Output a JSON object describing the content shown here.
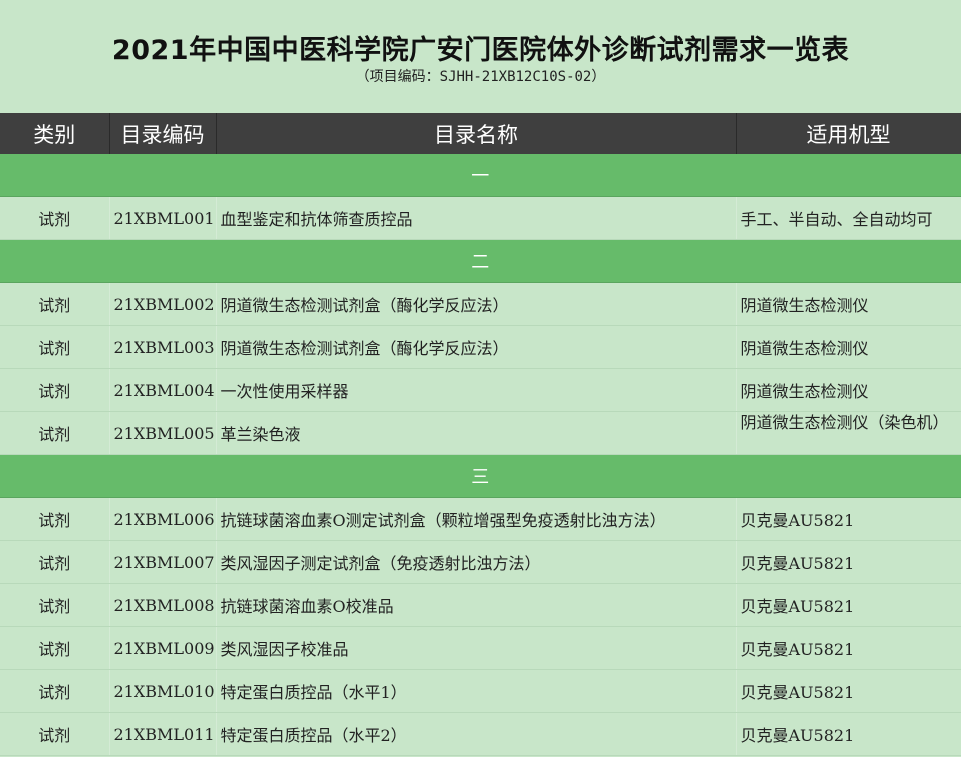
{
  "title": "2021年中国中医科学院广安门医院体外诊断试剂需求一览表",
  "subtitle": "（项目编码：SJHH-21XB12C10S-02）",
  "headers": [
    "类别",
    "目录编码",
    "目录名称",
    "适用机型"
  ],
  "sections": [
    {
      "label": "一",
      "rows": [
        {
          "category": "试剂",
          "code": "21XBML001",
          "name": "血型鉴定和抗体筛查质控品",
          "machine": "手工、半自动、全自动均可"
        }
      ]
    },
    {
      "label": "二",
      "rows": [
        {
          "category": "试剂",
          "code": "21XBML002",
          "name": "阴道微生态检测试剂盒（酶化学反应法）",
          "machine": "阴道微生态检测仪"
        },
        {
          "category": "试剂",
          "code": "21XBML003",
          "name": "阴道微生态检测试剂盒（酶化学反应法）",
          "machine": "阴道微生态检测仪"
        },
        {
          "category": "试剂",
          "code": "21XBML004",
          "name": "一次性使用采样器",
          "machine": "阴道微生态检测仪"
        },
        {
          "category": "试剂",
          "code": "21XBML005",
          "name": "革兰染色液",
          "machine": "阴道微生态检测仪（染色机）"
        }
      ]
    },
    {
      "label": "三",
      "rows": [
        {
          "category": "试剂",
          "code": "21XBML006",
          "name": "抗链球菌溶血素O测定试剂盒（颗粒增强型免疫透射比浊方法）",
          "machine": "贝克曼AU5821"
        },
        {
          "category": "试剂",
          "code": "21XBML007",
          "name": "类风湿因子测定试剂盒（免疫透射比浊方法）",
          "machine": "贝克曼AU5821"
        },
        {
          "category": "试剂",
          "code": "21XBML008",
          "name": "抗链球菌溶血素O校准品",
          "machine": "贝克曼AU5821"
        },
        {
          "category": "试剂",
          "code": "21XBML009",
          "name": "类风湿因子校准品",
          "machine": "贝克曼AU5821"
        },
        {
          "category": "试剂",
          "code": "21XBML010",
          "name": "特定蛋白质控品（水平1）",
          "machine": "贝克曼AU5821"
        },
        {
          "category": "试剂",
          "code": "21XBML011",
          "name": "特定蛋白质控品（水平2）",
          "machine": "贝克曼AU5821"
        }
      ]
    }
  ]
}
